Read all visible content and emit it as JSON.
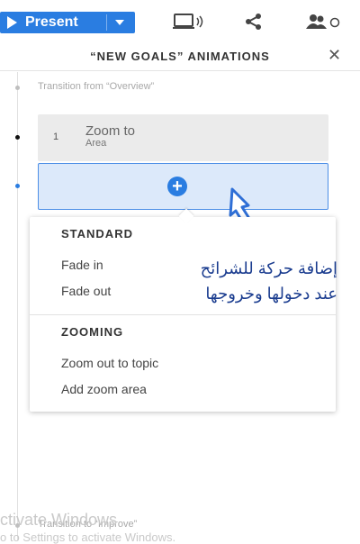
{
  "toolbar": {
    "present_label": "Present",
    "icons": [
      "present-play-icon",
      "dropdown-caret-icon",
      "broadcast-icon",
      "share-icon",
      "collaborators-icon"
    ]
  },
  "panel": {
    "title": "“NEW GOALS” ANIMATIONS",
    "transition_top": "Transition from “Overview”",
    "transition_bottom": "Transition to “Improve”"
  },
  "animation_item": {
    "number": "1",
    "line1": "Zoom to",
    "line2": "Area"
  },
  "dropdown": {
    "standard_heading": "STANDARD",
    "standard_items": [
      "Fade in",
      "Fade out"
    ],
    "zooming_heading": "ZOOMING",
    "zooming_items": [
      "Zoom out to topic",
      "Add zoom area"
    ]
  },
  "annotation": {
    "line1": "إضافة حركة  للشرائح",
    "line2": "عند دخولها وخروجها"
  },
  "watermark": {
    "line1": "ctivate Windows",
    "line2": "o to Settings to activate Windows."
  },
  "colors": {
    "accent": "#2a7de1",
    "add_bar_bg": "#dce9fa",
    "annotation_arrow": "#2f6fd6"
  }
}
